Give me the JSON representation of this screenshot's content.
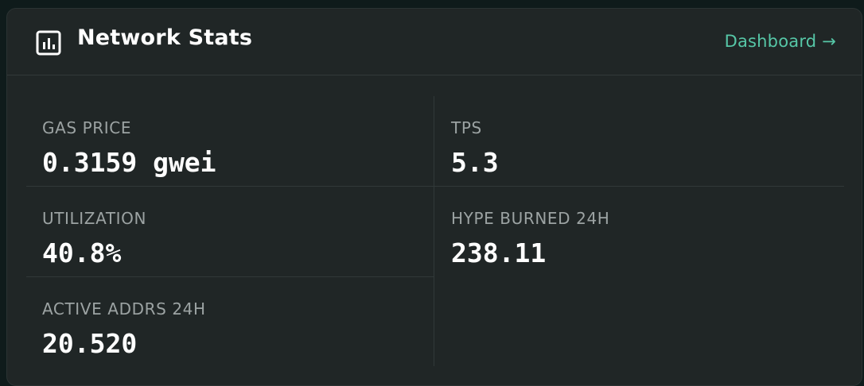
{
  "header": {
    "icon": "chart-icon",
    "title": "Network Stats",
    "dashboard_link": "Dashboard →"
  },
  "stats": {
    "gas_price": {
      "label": "GAS PRICE",
      "value": "0.3159 gwei"
    },
    "tps": {
      "label": "TPS",
      "value": "5.3"
    },
    "utilization": {
      "label": "UTILIZATION",
      "value": "40.8%"
    },
    "hype_burned": {
      "label": "HYPE BURNED 24H",
      "value": "238.11"
    },
    "active_addrs": {
      "label": "ACTIVE ADDRS 24H",
      "value": "20.520"
    }
  },
  "colors": {
    "background": "#0f1b1b",
    "card": "#202626",
    "divider": "#313939",
    "accent": "#56c7a7",
    "label": "#9ca3a3",
    "value": "#ffffff"
  }
}
